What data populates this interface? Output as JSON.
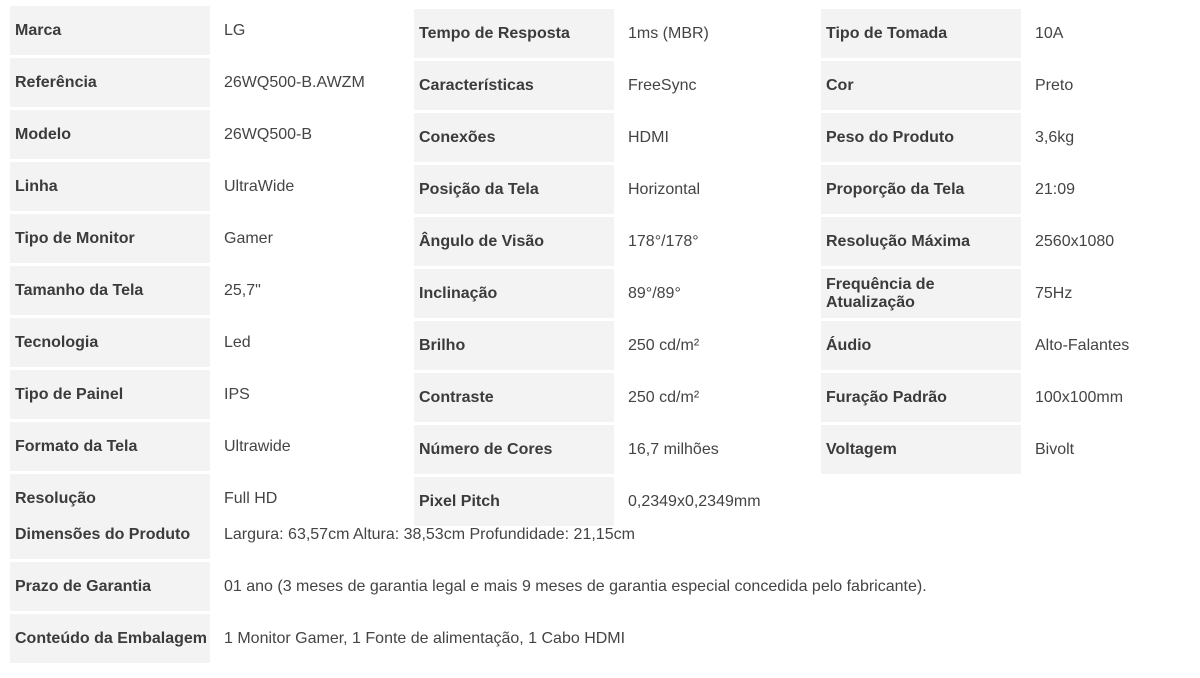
{
  "column1": [
    {
      "label": "Marca",
      "value": "LG"
    },
    {
      "label": "Referência",
      "value": "26WQ500-B.AWZM"
    },
    {
      "label": "Modelo",
      "value": "26WQ500-B"
    },
    {
      "label": "Linha",
      "value": "UltraWide"
    },
    {
      "label": "Tipo de Monitor",
      "value": "Gamer"
    },
    {
      "label": "Tamanho da Tela",
      "value": "25,7\""
    },
    {
      "label": "Tecnologia",
      "value": "Led"
    },
    {
      "label": "Tipo de Painel",
      "value": "IPS"
    },
    {
      "label": "Formato da Tela",
      "value": "Ultrawide"
    },
    {
      "label": "Resolução",
      "value": "Full HD"
    }
  ],
  "column2": [
    {
      "label": "Tempo de Resposta",
      "value": "1ms (MBR)"
    },
    {
      "label": "Características",
      "value": "FreeSync"
    },
    {
      "label": "Conexões",
      "value": "HDMI"
    },
    {
      "label": "Posição da Tela",
      "value": "Horizontal"
    },
    {
      "label": "Ângulo de Visão",
      "value": "178°/178°"
    },
    {
      "label": "Inclinação",
      "value": "89°/89°"
    },
    {
      "label": "Brilho",
      "value": "250 cd/m²"
    },
    {
      "label": "Contraste",
      "value": "250 cd/m²"
    },
    {
      "label": "Número de Cores",
      "value": "16,7 milhões"
    },
    {
      "label": "Pixel Pitch",
      "value": "0,2349x0,2349mm"
    }
  ],
  "column3": [
    {
      "label": "Tipo de Tomada",
      "value": "10A"
    },
    {
      "label": "Cor",
      "value": "Preto"
    },
    {
      "label": "Peso do Produto",
      "value": "3,6kg"
    },
    {
      "label": "Proporção da Tela",
      "value": "21:09"
    },
    {
      "label": "Resolução Máxima",
      "value": "2560x1080"
    },
    {
      "label": "Frequência de Atualização",
      "value": "75Hz"
    },
    {
      "label": "Áudio",
      "value": "Alto-Falantes"
    },
    {
      "label": "Furação Padrão",
      "value": "100x100mm"
    },
    {
      "label": "Voltagem",
      "value": "Bivolt"
    }
  ],
  "wide_rows": [
    {
      "label": "Dimensões do Produto",
      "value": "Largura: 63,57cm Altura: 38,53cm Profundidade: 21,15cm"
    },
    {
      "label": "Prazo de Garantia",
      "value": "01 ano (3 meses de garantia legal e mais 9 meses de garantia especial concedida pelo fabricante)."
    },
    {
      "label": "Conteúdo da Embalagem",
      "value": "1 Monitor Gamer, 1 Fonte de alimentação, 1 Cabo HDMI"
    }
  ]
}
